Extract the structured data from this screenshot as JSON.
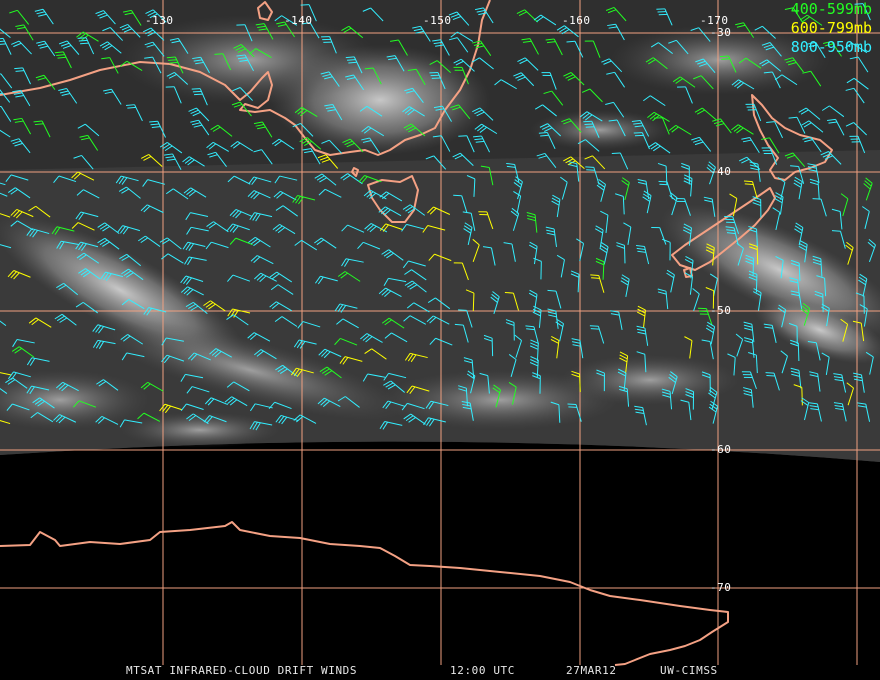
{
  "map": {
    "longitude_labels": [
      "-130",
      "-140",
      "-150",
      "-160",
      "-170"
    ],
    "latitude_labels": [
      "-30",
      "-40",
      "-50",
      "-60",
      "-70"
    ]
  },
  "legend": [
    {
      "label": "400-599mb",
      "color": "#22ff22"
    },
    {
      "label": "600-799mb",
      "color": "#ffff00"
    },
    {
      "label": "800-950mb",
      "color": "#33eeff"
    }
  ],
  "footer": {
    "product": "MTSAT INFRARED-CLOUD DRIFT WINDS",
    "time": "12:00 UTC",
    "date": "27MAR12",
    "source": "UW-CIMSS"
  },
  "colors": {
    "background": "#000000",
    "grid": "#f0a080",
    "coastline": "#f4a184",
    "high_level": "#22ff22",
    "mid_level": "#ffff00",
    "low_level": "#33eeff"
  }
}
